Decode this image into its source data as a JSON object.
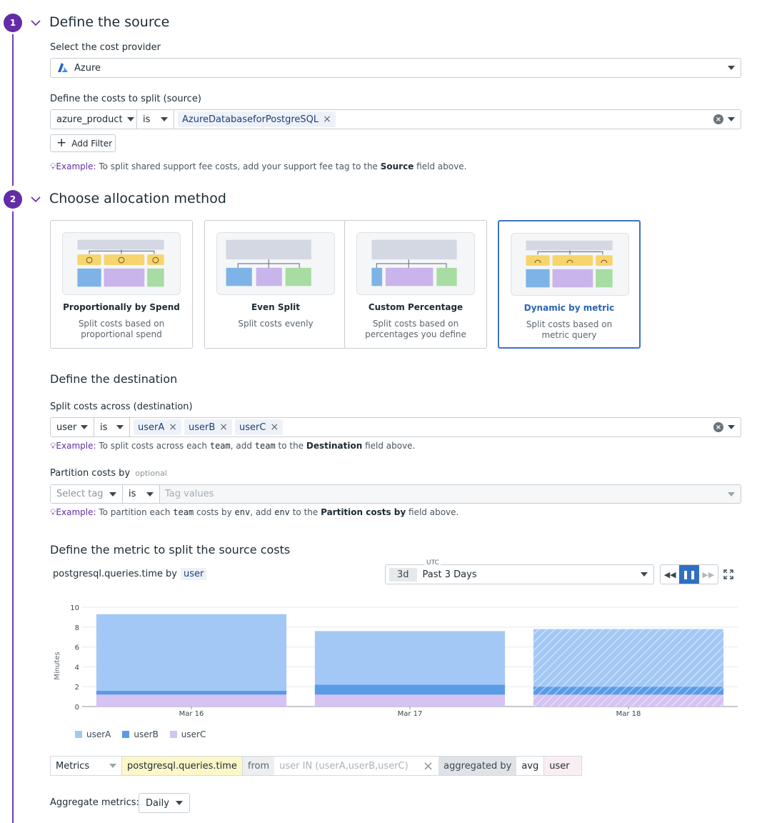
{
  "step1": {
    "number": "1",
    "title": "Define the source",
    "provider_label": "Select the cost provider",
    "provider_value": "Azure",
    "costs_label": "Define the costs to split (source)",
    "filter_key": "azure_product",
    "filter_op": "is",
    "filter_values": [
      "AzureDatabaseforPostgreSQL"
    ],
    "add_filter": "Add Filter",
    "hint_prefix": "Example:",
    "hint_text": " To split shared support fee costs, add your support fee tag to the ",
    "hint_bold": "Source",
    "hint_suffix": " field above."
  },
  "step2": {
    "number": "2",
    "title": "Choose allocation method",
    "methods": [
      {
        "title": "Proportionally by Spend",
        "desc": "Split costs based on proportional spend",
        "selected": false
      },
      {
        "title": "Even Split",
        "desc": "Split costs evenly",
        "selected": false
      },
      {
        "title": "Custom Percentage",
        "desc": "Split costs based on percentages you define",
        "selected": false
      },
      {
        "title": "Dynamic by metric",
        "desc": "Split costs based on metric query",
        "selected": true
      }
    ]
  },
  "destination": {
    "heading": "Define the destination",
    "label": "Split costs across (destination)",
    "key": "user",
    "op": "is",
    "values": [
      "userA",
      "userB",
      "userC"
    ],
    "hint_prefix": "Example:",
    "hint_t1": " To split costs across each ",
    "hint_c1": "team",
    "hint_t2": ", add ",
    "hint_c2": "team",
    "hint_t3": " to the ",
    "hint_bold": "Destination",
    "hint_t4": " field above."
  },
  "partition": {
    "label": "Partition costs by",
    "optional": "optional",
    "tag_placeholder": "Select tag",
    "op": "is",
    "values_placeholder": "Tag values",
    "hint_prefix": "Example:",
    "hint_t1": " To partition each ",
    "hint_c1": "team",
    "hint_t2": " costs by ",
    "hint_c2": "env",
    "hint_t3": ", add ",
    "hint_c3": "env",
    "hint_t4": " to the ",
    "hint_bold": "Partition costs by",
    "hint_t5": " field above."
  },
  "metric": {
    "heading": "Define the metric to split the source costs",
    "query_title": "postgresql.queries.time by",
    "query_group": "user",
    "tz": "UTC",
    "range_short": "3d",
    "range_label": "Past 3 Days"
  },
  "chart_data": {
    "type": "bar",
    "stacked": true,
    "ylabel": "Minutes",
    "ylim": [
      0,
      10
    ],
    "yticks": [
      "0",
      "2",
      "4",
      "6",
      "8",
      "10"
    ],
    "categories": [
      "Mar 16",
      "Mar 17",
      "Mar 18"
    ],
    "series": [
      {
        "name": "userC",
        "color": "#d5c3f3",
        "values": [
          1.2,
          1.2,
          1.2
        ]
      },
      {
        "name": "userB",
        "color": "#5a9be6",
        "values": [
          0.4,
          1.0,
          0.8
        ]
      },
      {
        "name": "userA",
        "color": "#a3c8f6",
        "values": [
          7.7,
          5.4,
          5.8
        ]
      }
    ],
    "partial_last": true,
    "grid": true,
    "legend": "bottom-left"
  },
  "query_bar": {
    "source": "Metrics",
    "metric": "postgresql.queries.time",
    "from": "from",
    "filter": "user IN (userA,userB,userC)",
    "aggregated_by": "aggregated by",
    "agg": "avg",
    "group": "user"
  },
  "aggregate": {
    "label": "Aggregate metrics:",
    "value": "Daily"
  }
}
